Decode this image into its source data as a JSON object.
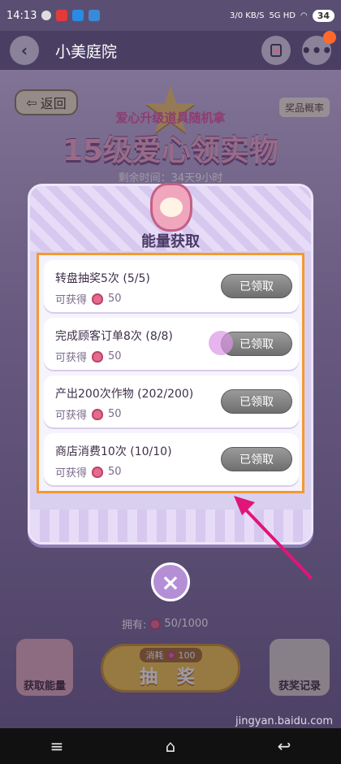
{
  "status_bar": {
    "time": "14:13",
    "network": "3/0 KB/S",
    "signal": "5G HD",
    "battery": "34"
  },
  "app_header": {
    "title": "小美庭院"
  },
  "game": {
    "back_label": "返回",
    "prize_odds_label": "奖品概率",
    "event_subtitle": "爱心升级道具随机拿",
    "event_title": "15级爱心领实物",
    "countdown": "剩余时间：34天9小时",
    "owned_label": "拥有:",
    "owned_value": "50/1000",
    "get_energy_label": "获取能量",
    "draw_cost_label": "消耗",
    "draw_cost_value": "100",
    "draw_label": "抽 奖",
    "records_label": "获奖记录"
  },
  "modal": {
    "title": "能量获取",
    "tasks": [
      {
        "name": "转盘抽奖5次 (5/5)",
        "reward_label": "可获得",
        "reward_value": "50",
        "button": "已领取"
      },
      {
        "name": "完成顾客订单8次 (8/8)",
        "reward_label": "可获得",
        "reward_value": "50",
        "button": "已领取"
      },
      {
        "name": "产出200次作物 (202/200)",
        "reward_label": "可获得",
        "reward_value": "50",
        "button": "已领取"
      },
      {
        "name": "商店消费10次 (10/10)",
        "reward_label": "可获得",
        "reward_value": "50",
        "button": "已领取"
      }
    ],
    "close_symbol": "×"
  },
  "watermark": "jingyan.baidu.com",
  "colors": {
    "highlight": "#f39a2e",
    "annotation": "#e0157a",
    "claimed_button": "#7a7a7a"
  },
  "icons": {
    "back": "back-arrow-icon",
    "bookmark": "bookmark-icon",
    "more": "more-icon",
    "energy": "energy-heart-icon",
    "close": "close-icon"
  }
}
